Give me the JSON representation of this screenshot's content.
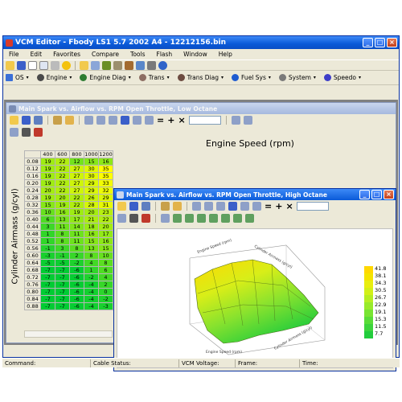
{
  "window": {
    "title": "VCM Editor - Fbody LS1 5.7 2002 A4 - 12212156.bin"
  },
  "menu": [
    "File",
    "Edit",
    "Favorites",
    "Compare",
    "Tools",
    "Flash",
    "Window",
    "Help"
  ],
  "nav": [
    {
      "label": "OS",
      "color": "#3a6fd8"
    },
    {
      "label": "Engine",
      "color": "#4a4a4a"
    },
    {
      "label": "Engine Diag",
      "color": "#2e7d32"
    },
    {
      "label": "Trans",
      "color": "#8d6e63"
    },
    {
      "label": "Trans Diag",
      "color": "#6d4c41"
    },
    {
      "label": "Fuel Sys",
      "color": "#1e5bd0"
    },
    {
      "label": "System",
      "color": "#7a7a7a"
    },
    {
      "label": "Speedo",
      "color": "#3d3dc8"
    }
  ],
  "low_table": {
    "title": "Main Spark vs. Airflow vs. RPM Open Throttle, Low Octane",
    "x_axis_label": "Engine Speed (rpm)",
    "y_axis_label": "Cylinder Airmass (g/cyl)",
    "columns": [
      "400",
      "600",
      "800",
      "1000",
      "1200"
    ],
    "rows": [
      {
        "airmass": "0.08",
        "cells": [
          "19",
          "22",
          "12",
          "15",
          "16"
        ]
      },
      {
        "airmass": "0.12",
        "cells": [
          "19",
          "22",
          "27",
          "30",
          "35"
        ]
      },
      {
        "airmass": "0.16",
        "cells": [
          "19",
          "22",
          "27",
          "30",
          "35"
        ]
      },
      {
        "airmass": "0.20",
        "cells": [
          "19",
          "22",
          "27",
          "29",
          "33"
        ]
      },
      {
        "airmass": "0.24",
        "cells": [
          "20",
          "22",
          "27",
          "29",
          "32"
        ]
      },
      {
        "airmass": "0.28",
        "cells": [
          "19",
          "20",
          "22",
          "26",
          "29"
        ]
      },
      {
        "airmass": "0.32",
        "cells": [
          "15",
          "19",
          "22",
          "28",
          "31"
        ]
      },
      {
        "airmass": "0.36",
        "cells": [
          "10",
          "16",
          "19",
          "20",
          "23"
        ]
      },
      {
        "airmass": "0.40",
        "cells": [
          "6",
          "13",
          "17",
          "21",
          "22"
        ]
      },
      {
        "airmass": "0.44",
        "cells": [
          "3",
          "11",
          "14",
          "18",
          "20"
        ]
      },
      {
        "airmass": "0.48",
        "cells": [
          "1",
          "8",
          "11",
          "16",
          "17"
        ]
      },
      {
        "airmass": "0.52",
        "cells": [
          "1",
          "8",
          "11",
          "15",
          "16"
        ]
      },
      {
        "airmass": "0.56",
        "cells": [
          "-1",
          "3",
          "8",
          "13",
          "15"
        ]
      },
      {
        "airmass": "0.60",
        "cells": [
          "-3",
          "-1",
          "2",
          "8",
          "10"
        ]
      },
      {
        "airmass": "0.64",
        "cells": [
          "-5",
          "-5",
          "-2",
          "4",
          "8"
        ]
      },
      {
        "airmass": "0.68",
        "cells": [
          "-7",
          "-7",
          "-6",
          "1",
          "6"
        ]
      },
      {
        "airmass": "0.72",
        "cells": [
          "-7",
          "-7",
          "-6",
          "-2",
          "4"
        ]
      },
      {
        "airmass": "0.76",
        "cells": [
          "-7",
          "-7",
          "-6",
          "-4",
          "2"
        ]
      },
      {
        "airmass": "0.80",
        "cells": [
          "-7",
          "-7",
          "-6",
          "-4",
          "0"
        ]
      },
      {
        "airmass": "0.84",
        "cells": [
          "-7",
          "-7",
          "-6",
          "-4",
          "-2"
        ]
      },
      {
        "airmass": "0.88",
        "cells": [
          "-7",
          "-7",
          "-6",
          "-4",
          "-3"
        ]
      }
    ]
  },
  "high_view": {
    "title": "Main Spark vs. Airflow vs. RPM Open Throttle, High Octane",
    "legend": [
      {
        "value": "41.8",
        "color": "#ffd800"
      },
      {
        "value": "38.1",
        "color": "#f4e400"
      },
      {
        "value": "34.3",
        "color": "#e8ee10"
      },
      {
        "value": "30.5",
        "color": "#d2f018"
      },
      {
        "value": "26.7",
        "color": "#b6ee22"
      },
      {
        "value": "22.9",
        "color": "#98ea2a"
      },
      {
        "value": "19.1",
        "color": "#78e432"
      },
      {
        "value": "15.3",
        "color": "#58dc38"
      },
      {
        "value": "11.5",
        "color": "#3cd43c"
      },
      {
        "value": "7.7",
        "color": "#22cc3c"
      }
    ]
  },
  "status": {
    "command": "Command:",
    "cable": "Cable Status:",
    "voltage": "VCM Voltage:",
    "frame": "Frame:",
    "time": "Time:"
  },
  "colors": {
    "accent": "#0a5ad8",
    "cell_high": "#ffff00",
    "cell_low": "#00cc33"
  }
}
